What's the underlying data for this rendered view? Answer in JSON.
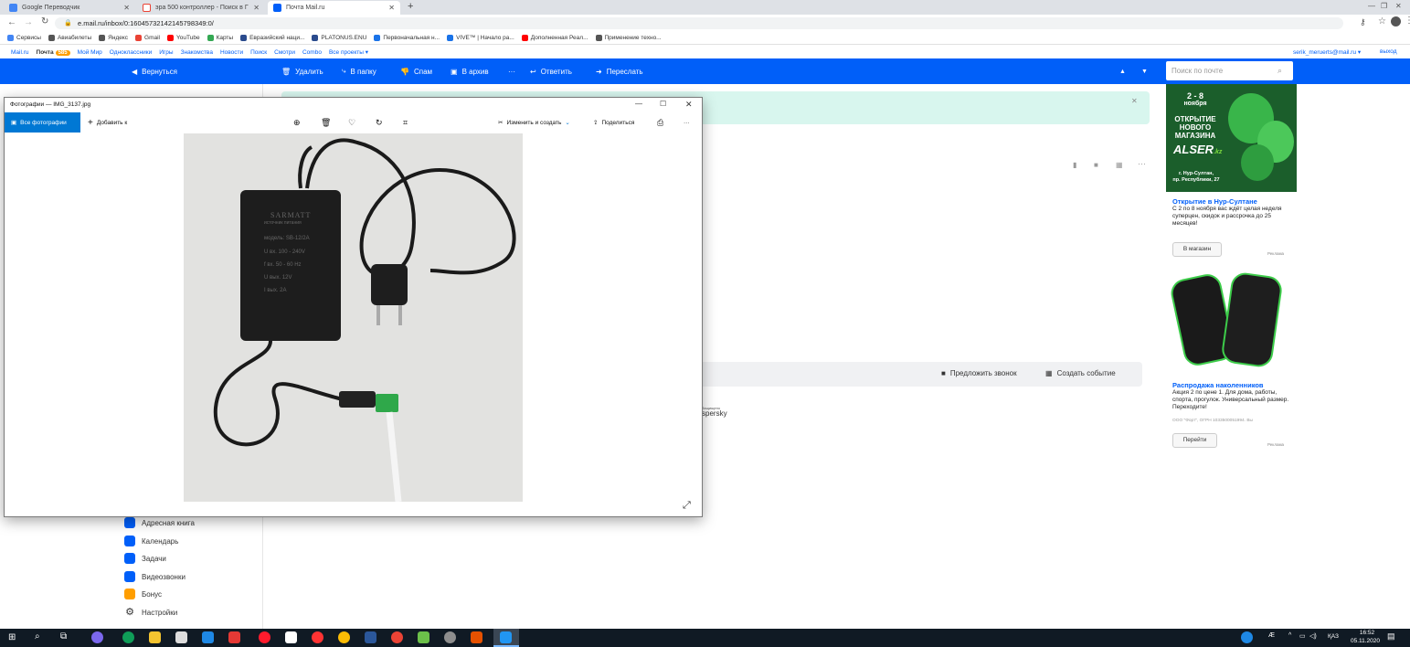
{
  "browser": {
    "tabs": [
      {
        "title": "Google Переводчик",
        "active": false,
        "color": "#4285f4"
      },
      {
        "title": "эра 500 контроллер - Поиск в Г",
        "active": false,
        "color": "#ea4335"
      },
      {
        "title": "Почта Mail.ru",
        "active": true,
        "color": "#005ff9"
      }
    ],
    "new_tab": "+",
    "url": "e.mail.ru/inbox/0:16045732142145798349:0/",
    "bookmarks": [
      {
        "label": "Сервисы",
        "color": "#4285f4"
      },
      {
        "label": "Авиабилеты",
        "color": "#555555"
      },
      {
        "label": "Яндекс",
        "color": "#555555"
      },
      {
        "label": "Gmail",
        "color": "#ea4335"
      },
      {
        "label": "YouTube",
        "color": "#ff0000"
      },
      {
        "label": "Карты",
        "color": "#34a853"
      },
      {
        "label": "Евразийский наци...",
        "color": "#2a4b8d"
      },
      {
        "label": "PLATONUS.ENU",
        "color": "#2a4b8d"
      },
      {
        "label": "Первоначальная н...",
        "color": "#1a73e8"
      },
      {
        "label": "VIVE™ | Начало ра...",
        "color": "#1a73e8"
      },
      {
        "label": "Дополненная Реал...",
        "color": "#ff0000"
      },
      {
        "label": "Применение техно...",
        "color": "#555555"
      }
    ]
  },
  "portal": {
    "links": [
      "Mail.ru",
      "Почта",
      "Мой Мир",
      "Одноклассники",
      "Игры",
      "Знакомства",
      "Новости",
      "Поиск",
      "Смотри",
      "Combo",
      "Все проекты ▾"
    ],
    "mail_badge": "585",
    "user": "serik_meruerts@mail.ru ▾",
    "logout": "выход"
  },
  "mailbar": {
    "back": "Вернуться",
    "delete": "Удалить",
    "move": "В папку",
    "spam": "Спам",
    "archive": "В архив",
    "more": "···",
    "reply": "Ответить",
    "forward": "Переслать",
    "search_placeholder": "Поиск по почте"
  },
  "sidebar": {
    "items": [
      {
        "label": "Адресная книга",
        "icon": "address-book-icon"
      },
      {
        "label": "Календарь",
        "icon": "calendar-icon"
      },
      {
        "label": "Задачи",
        "icon": "tasks-icon"
      },
      {
        "label": "Видеозвонки",
        "icon": "video-call-icon"
      },
      {
        "label": "Бонус",
        "icon": "bonus-icon"
      },
      {
        "label": "Настройки",
        "icon": "settings-icon"
      }
    ]
  },
  "message": {
    "propose_call": "Предложить звонок",
    "create_event": "Создать событие",
    "antivirus_small": "Защищено",
    "antivirus": "spersky"
  },
  "viewer": {
    "title": "Фотографии — IMG_3137.jpg",
    "all_photos": "Все фотографии",
    "add_to": "Добавить к",
    "edit_create": "Изменить и создать",
    "share": "Поделиться",
    "more": "···",
    "adapter_brand": "SARMATT",
    "adapter_lines": [
      "источник питания",
      "модель: SB-12/2A",
      "U вх. 100 - 240V",
      "f вх. 50 - 60 Hz",
      "U вых. 12V",
      "I вых. 2A"
    ]
  },
  "ads": {
    "banner1": {
      "date": "2 - 8",
      "month": "ноября",
      "line1": "ОТКРЫТИЕ",
      "line2": "НОВОГО",
      "line3": "МАГАЗИНА",
      "brand": "ALSER",
      "brand_suffix": ".kz",
      "address": "г. Нур-Султан,",
      "address2": "пр. Республики, 27"
    },
    "ad1_title": "Открытие в Нур-Султане",
    "ad1_text": "С 2 по 8 ноября вас ждёт целая неделя суперцен, скидок и рассрочка до 25 месяцев!",
    "ad1_button": "В магазин",
    "ad_label": "Реклама",
    "ad2_title": "Распродажа наколенников",
    "ad2_text": "Акция 2 по цене 1. Для дома, работы, спорта, прогулок. Универсальный размер. Переходите!",
    "ad2_legal": "ООО \"Форт\", ОГРН 1033500051994. Вы",
    "ad2_button": "Перейти",
    "ad2_label": "Реклама"
  },
  "taskbar": {
    "lang": "ҚАЗ",
    "time": "16:52",
    "date": "05.11.2020",
    "icons": [
      "start-icon",
      "search-icon",
      "task-view-icon",
      "teams-icon",
      "edge-icon",
      "explorer-icon",
      "store-icon",
      "mail-icon",
      "app1-icon",
      "opera-icon",
      "notepad-icon",
      "yandex-icon",
      "chrome-icon",
      "word-icon",
      "chrome-alt-icon",
      "app2-icon",
      "app3-icon",
      "app4-icon",
      "photos-icon"
    ]
  }
}
